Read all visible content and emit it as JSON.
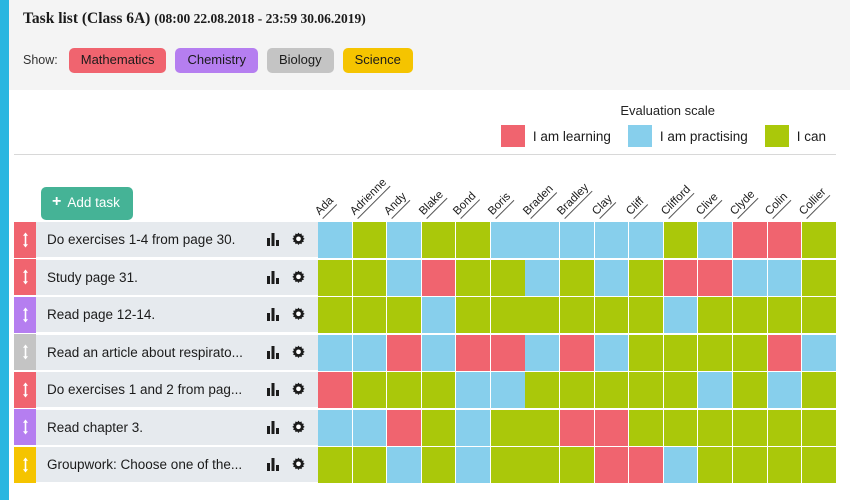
{
  "header": {
    "title": "Task list (Class 6A)",
    "date_range": "(08:00 22.08.2018 - 23:59 30.06.2019)",
    "show_label": "Show:",
    "filters": [
      {
        "label": "Mathematics",
        "color": "#f0646f"
      },
      {
        "label": "Chemistry",
        "color": "#b57ef0"
      },
      {
        "label": "Biology",
        "color": "#c4c4c4"
      },
      {
        "label": "Science",
        "color": "#f5c400"
      }
    ]
  },
  "legend": {
    "title": "Evaluation scale",
    "items": [
      {
        "label": "I am learning",
        "color": "#f0646f"
      },
      {
        "label": "I am practising",
        "color": "#87cfec"
      },
      {
        "label": "I can",
        "color": "#aac80a"
      }
    ]
  },
  "toolbar": {
    "add_task_label": "Add task",
    "add_task_plus": "+"
  },
  "grid": {
    "students": [
      "Ada",
      "Adrienne",
      "Andy",
      "Blake",
      "Bond",
      "Boris",
      "Braden",
      "Bradley",
      "Clay",
      "Cliff",
      "Clifford",
      "Clive",
      "Clyde",
      "Colin",
      "Collier"
    ],
    "status_colors": {
      "learning": "#f0646f",
      "practising": "#87cfec",
      "can": "#aac80a"
    },
    "icons": {
      "bar_chart": "bar-chart-icon",
      "gear": "gear-icon",
      "reorder": "reorder-arrows-icon"
    },
    "rows": [
      {
        "task": "Do exercises 1-4 from page 30.",
        "subject_color": "#f0646f",
        "cells": [
          "practising",
          "can",
          "practising",
          "can",
          "can",
          "practising",
          "practising",
          "practising",
          "practising",
          "practising",
          "can",
          "practising",
          "learning",
          "learning",
          "can"
        ]
      },
      {
        "task": "Study page 31.",
        "subject_color": "#f0646f",
        "cells": [
          "can",
          "can",
          "practising",
          "learning",
          "can",
          "can",
          "practising",
          "can",
          "practising",
          "can",
          "learning",
          "learning",
          "practising",
          "practising",
          "can"
        ]
      },
      {
        "task": "Read page 12-14.",
        "subject_color": "#b57ef0",
        "cells": [
          "can",
          "can",
          "can",
          "practising",
          "can",
          "can",
          "can",
          "can",
          "can",
          "can",
          "practising",
          "can",
          "can",
          "can",
          "can"
        ]
      },
      {
        "task": "Read an article about respirato...",
        "subject_color": "#c4c4c4",
        "cells": [
          "practising",
          "practising",
          "learning",
          "practising",
          "learning",
          "learning",
          "practising",
          "learning",
          "practising",
          "can",
          "can",
          "can",
          "can",
          "learning",
          "practising"
        ]
      },
      {
        "task": "Do exercises 1 and 2 from pag...",
        "subject_color": "#f0646f",
        "cells": [
          "learning",
          "can",
          "can",
          "can",
          "practising",
          "practising",
          "can",
          "can",
          "can",
          "can",
          "can",
          "practising",
          "can",
          "practising",
          "can"
        ]
      },
      {
        "task": "Read chapter 3.",
        "subject_color": "#b57ef0",
        "cells": [
          "practising",
          "practising",
          "learning",
          "can",
          "practising",
          "can",
          "can",
          "learning",
          "learning",
          "can",
          "can",
          "can",
          "can",
          "can",
          "can"
        ]
      },
      {
        "task": "Groupwork: Choose one of the...",
        "subject_color": "#f5c400",
        "cells": [
          "can",
          "can",
          "practising",
          "can",
          "practising",
          "can",
          "can",
          "can",
          "learning",
          "learning",
          "practising",
          "can",
          "can",
          "can",
          "can"
        ]
      }
    ]
  }
}
